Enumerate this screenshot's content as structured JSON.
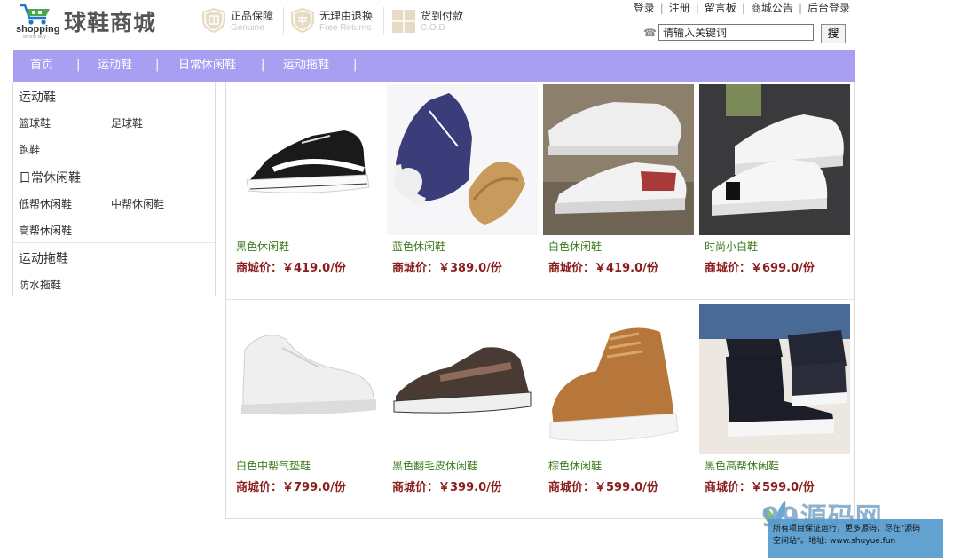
{
  "header": {
    "logo_text": "shopping",
    "logo_sub": "online buy",
    "brand": "球鞋商城",
    "features": [
      {
        "title": "正品保障",
        "sub": "Genuine"
      },
      {
        "title": "无理由退换",
        "sub": "Free Returns"
      },
      {
        "title": "货到付款",
        "sub": "C.O.D"
      }
    ],
    "links": [
      {
        "label": "登录"
      },
      {
        "label": "注册"
      },
      {
        "label": "留言板"
      },
      {
        "label": "商城公告"
      },
      {
        "label": "后台登录"
      }
    ],
    "search": {
      "value": "请输入关键词",
      "button": "搜"
    }
  },
  "nav": {
    "items": [
      "首页",
      "运动鞋",
      "日常休闲鞋",
      "运动拖鞋"
    ],
    "separator": "|"
  },
  "sidebar": {
    "categories": [
      {
        "title": "运动鞋",
        "items": [
          "篮球鞋",
          "足球鞋",
          "跑鞋"
        ]
      },
      {
        "title": "日常休闲鞋",
        "items": [
          "低帮休闲鞋",
          "中帮休闲鞋",
          "高帮休闲鞋"
        ]
      },
      {
        "title": "运动拖鞋",
        "items": [
          "防水拖鞋"
        ]
      }
    ]
  },
  "products": [
    {
      "name": "黑色休闲鞋",
      "price": "商城价：￥419.0/份"
    },
    {
      "name": "蓝色休闲鞋",
      "price": "商城价：￥389.0/份"
    },
    {
      "name": "白色休闲鞋",
      "price": "商城价：￥419.0/份"
    },
    {
      "name": "时尚小白鞋",
      "price": "商城价：￥699.0/份"
    },
    {
      "name": "白色中帮气垫鞋",
      "price": "商城价：￥799.0/份"
    },
    {
      "name": "黑色翻毛皮休闲鞋",
      "price": "商城价：￥399.0/份"
    },
    {
      "name": "棕色休闲鞋",
      "price": "商城价：￥599.0/份"
    },
    {
      "name": "黑色高帮休闲鞋",
      "price": "商城价：￥599.0/份"
    }
  ],
  "watermark": {
    "logo": "99源码网",
    "line1": "所有项目保证运行，更多源码，尽在\"源码",
    "line2": "空间站\"。地址: www.shuyue.fun"
  },
  "colors": {
    "nav_bg": "#a89ff3",
    "product_name": "#3a7a1a",
    "price": "#8b1d1d"
  }
}
